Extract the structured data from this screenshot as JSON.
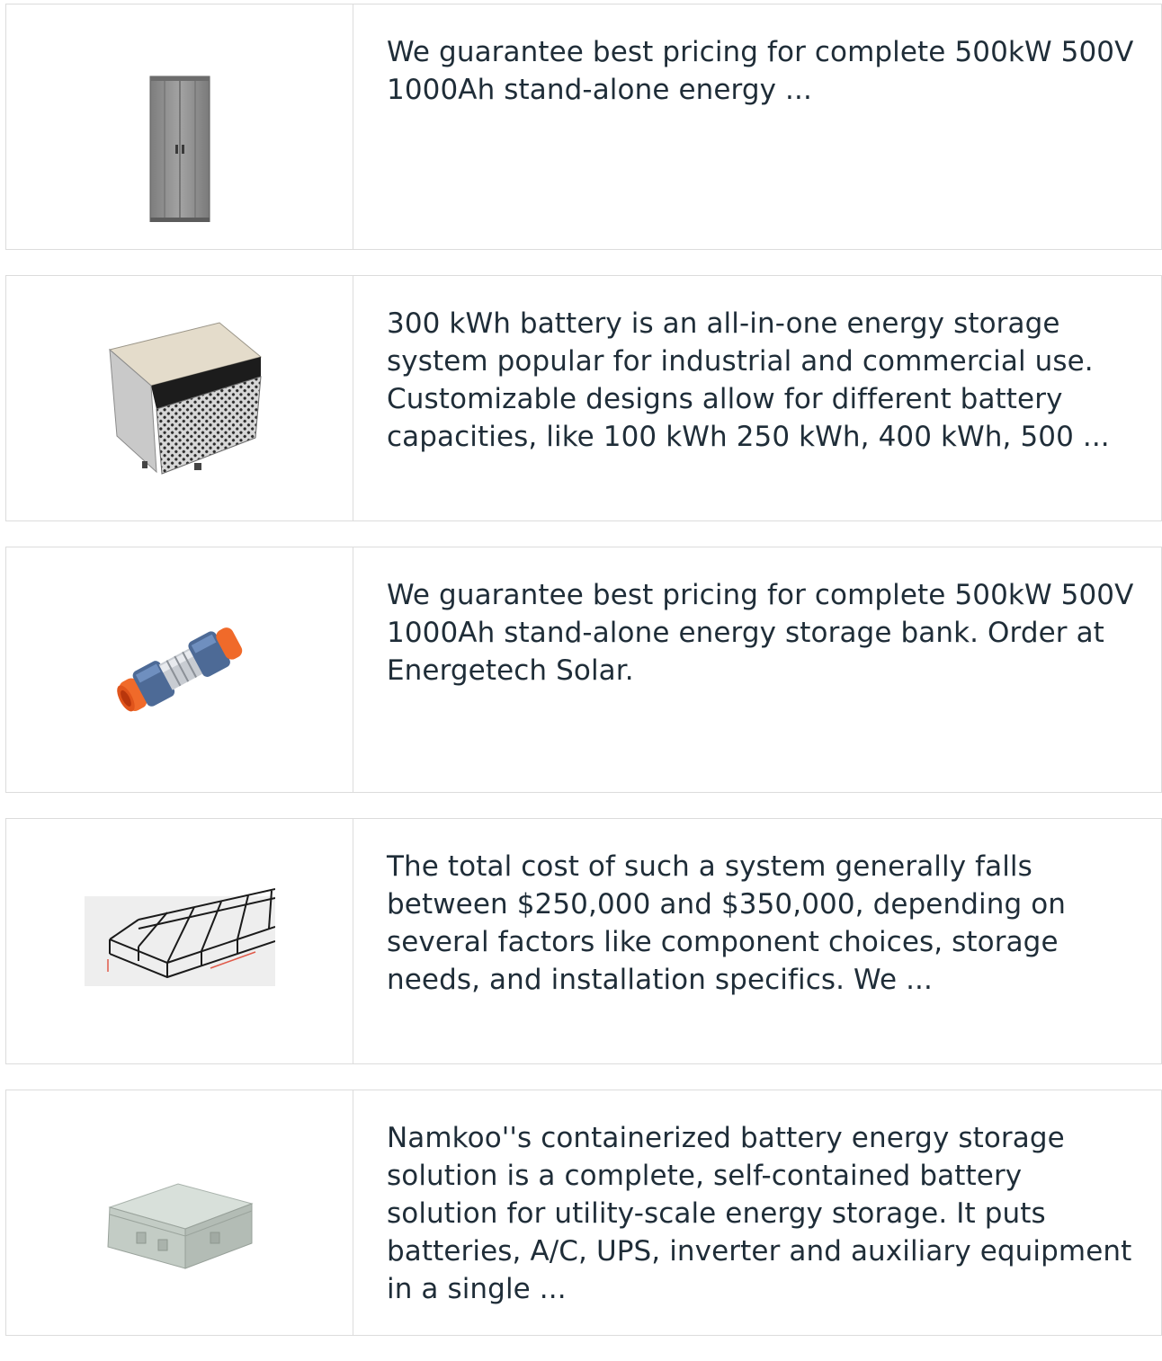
{
  "products": [
    {
      "image_icon": "metal-cabinet-image",
      "description": "We guarantee best pricing for complete 500kW 500V 1000Ah stand-alone energy ..."
    },
    {
      "image_icon": "battery-enclosure-image",
      "description": "300 kWh battery is an all-in-one energy storage system popular for industrial and commercial use. Customizable designs allow for different battery capacities, like 100 kWh 250 kWh, 400 kWh, 500 ..."
    },
    {
      "image_icon": "pipe-connector-image",
      "description": "We guarantee best pricing for complete 500kW 500V 1000Ah stand-alone energy storage bank. Order at Energetech Solar."
    },
    {
      "image_icon": "wire-mesh-tray-image",
      "description": "The total cost of such a system generally falls between $250,000 and $350,000, depending on several factors like component choices, storage needs, and installation specifics. We ..."
    },
    {
      "image_icon": "junction-box-image",
      "description": "Namkoo''s containerized battery energy storage solution is a complete, self-contained battery solution for utility-scale energy storage. It puts batteries, A/C, UPS, inverter and auxiliary equipment in a single ..."
    }
  ],
  "colors": {
    "border": "#dcdcdc",
    "text": "#1f2d38",
    "connector_orange": "#f06a2a",
    "cabinet_gray": "#8e8e8e"
  }
}
